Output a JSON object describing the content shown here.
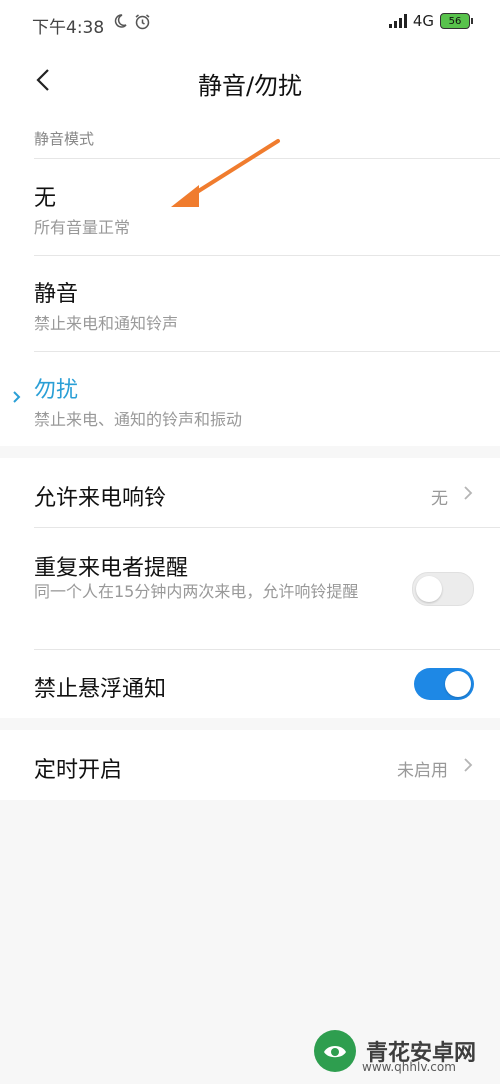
{
  "status": {
    "time": "下午4:38",
    "network": "4G",
    "battery": "56"
  },
  "header": {
    "title": "静音/勿扰"
  },
  "mode": {
    "section_label": "静音模式",
    "options": [
      {
        "title": "无",
        "subtitle": "所有音量正常",
        "selected": false
      },
      {
        "title": "静音",
        "subtitle": "禁止来电和通知铃声",
        "selected": false
      },
      {
        "title": "勿扰",
        "subtitle": "禁止来电、通知的铃声和振动",
        "selected": true
      }
    ]
  },
  "settings": {
    "allow_calls": {
      "title": "允许来电响铃",
      "value": "无"
    },
    "repeat_callers": {
      "title": "重复来电者提醒",
      "subtitle": "同一个人在15分钟内两次来电，允许响铃提醒",
      "enabled": false
    },
    "block_floating": {
      "title": "禁止悬浮通知",
      "enabled": true
    }
  },
  "schedule": {
    "title": "定时开启",
    "value": "未启用"
  },
  "watermark": {
    "name": "青花安卓网",
    "url": "www.qhhlv.com"
  },
  "colors": {
    "accent": "#2a9fd6",
    "toggle_on": "#1e88e5",
    "arrow": "#f07c2e"
  }
}
